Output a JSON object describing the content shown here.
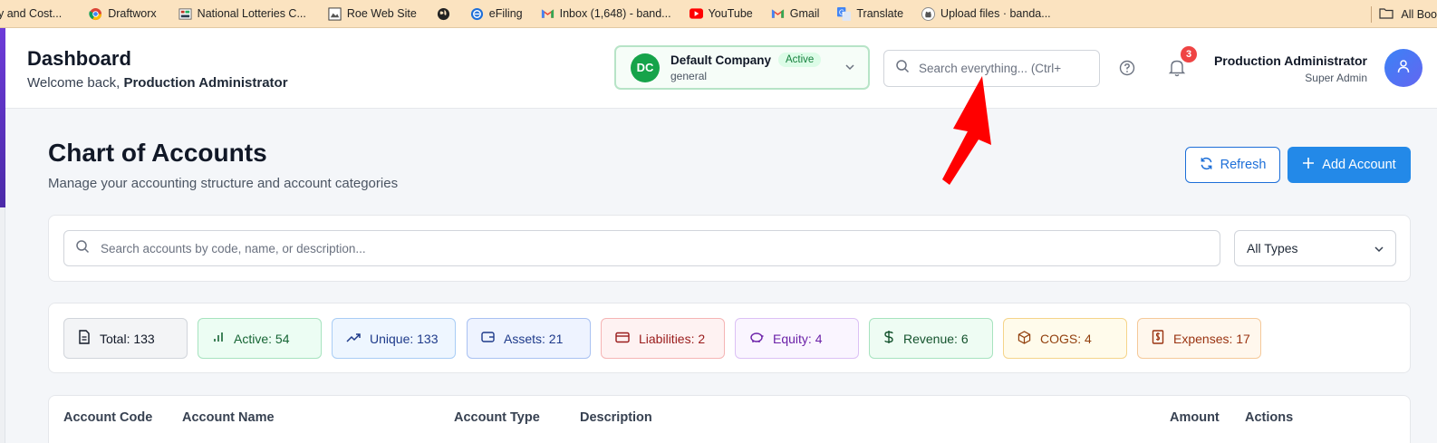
{
  "bookmarks": {
    "items": [
      {
        "label": "y and Cost...",
        "icon": "none"
      },
      {
        "label": "Draftworx",
        "icon": "chrome-icon"
      },
      {
        "label": "National Lotteries C...",
        "icon": "lotteries-icon"
      },
      {
        "label": "Roe Web Site",
        "icon": "page-icon"
      },
      {
        "label": "",
        "icon": "globe-icon"
      },
      {
        "label": "eFiling",
        "icon": "efiling-icon"
      },
      {
        "label": "Inbox (1,648) - band...",
        "icon": "gmail-icon"
      },
      {
        "label": "YouTube",
        "icon": "youtube-icon"
      },
      {
        "label": "Gmail",
        "icon": "gmail-icon"
      },
      {
        "label": "Translate",
        "icon": "translate-icon"
      },
      {
        "label": "Upload files · banda...",
        "icon": "github-icon"
      }
    ],
    "all_bookmarks": "All Boo"
  },
  "header": {
    "title": "Dashboard",
    "welcome_prefix": "Welcome back,",
    "welcome_user": "Production Administrator",
    "company": {
      "initials": "DC",
      "name": "Default Company",
      "status": "Active",
      "sub": "general"
    },
    "search_placeholder": "Search everything... (Ctrl+",
    "notification_count": "3",
    "user_name": "Production Administrator",
    "user_role": "Super Admin"
  },
  "page": {
    "title": "Chart of Accounts",
    "subtitle": "Manage your accounting structure and account categories",
    "refresh_label": "Refresh",
    "add_label": "Add Account"
  },
  "filters": {
    "search_placeholder": "Search accounts by code, name, or description...",
    "type_selected": "All Types"
  },
  "stats": [
    {
      "label": "Total: 133",
      "icon": "document-icon",
      "bg": "#f3f4f6",
      "border": "#d1d5db",
      "color": "#111827"
    },
    {
      "label": "Active: 54",
      "icon": "bar-chart-icon",
      "bg": "#ecfdf3",
      "border": "#a7e3bf",
      "color": "#166534"
    },
    {
      "label": "Unique: 133",
      "icon": "trending-up-icon",
      "bg": "#eef6ff",
      "border": "#a9cdf5",
      "color": "#1e3a8a"
    },
    {
      "label": "Assets: 21",
      "icon": "wallet-icon",
      "bg": "#eef3ff",
      "border": "#a9c1f2",
      "color": "#1e3a8a"
    },
    {
      "label": "Liabilities: 2",
      "icon": "credit-card-icon",
      "bg": "#fef2f2",
      "border": "#f5b5b5",
      "color": "#991b1b"
    },
    {
      "label": "Equity: 4",
      "icon": "piggy-bank-icon",
      "bg": "#faf5ff",
      "border": "#dcc1f5",
      "color": "#6b21a8"
    },
    {
      "label": "Revenue: 6",
      "icon": "dollar-icon",
      "bg": "#eefcf3",
      "border": "#a7e3bf",
      "color": "#14532d"
    },
    {
      "label": "COGS: 4",
      "icon": "package-icon",
      "bg": "#fffbeb",
      "border": "#f5d48a",
      "color": "#92400e"
    },
    {
      "label": "Expenses: 17",
      "icon": "receipt-icon",
      "bg": "#fff7ed",
      "border": "#f5c99a",
      "color": "#9a3412"
    }
  ],
  "table": {
    "headers": [
      "Account Code",
      "Account Name",
      "Account Type",
      "Description",
      "Amount",
      "Actions"
    ]
  }
}
